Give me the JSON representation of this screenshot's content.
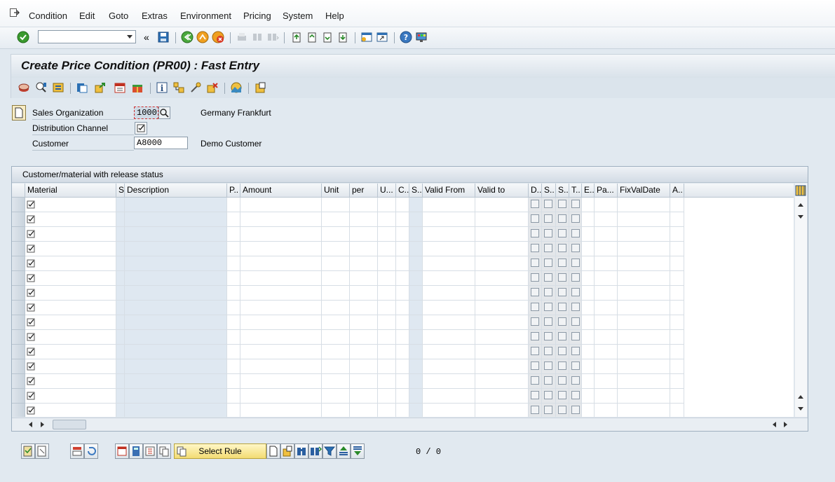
{
  "menu": [
    "Condition",
    "Edit",
    "Goto",
    "Extras",
    "Environment",
    "Pricing",
    "System",
    "Help"
  ],
  "title": "Create Price Condition (PR00) : Fast Entry",
  "fields": {
    "sales_org_label": "Sales Organization",
    "sales_org_value": "1000",
    "sales_org_desc": "Germany Frankfurt",
    "dist_channel_label": "Distribution Channel",
    "customer_label": "Customer",
    "customer_value": "A8000",
    "customer_desc": "Demo Customer"
  },
  "table": {
    "title": "Customer/material with release status",
    "headers": [
      "Material",
      "S",
      "Description",
      "P..",
      "Amount",
      "Unit",
      "per",
      "U...",
      "C..",
      "S..",
      "Valid From",
      "Valid to",
      "D..",
      "S..",
      "S..",
      "T..",
      "E..",
      "Pa...",
      "FixValDate",
      "A.."
    ],
    "row_count": 15
  },
  "bottom": {
    "select_rule_label": "Select Rule",
    "page_counter": "0  /  0"
  },
  "colors": {
    "background": "#e1e9f0",
    "title_bar": "#d9e2ea",
    "readonly_cell": "#dfe8f1",
    "select_rule_button": "#f3dc73"
  },
  "icons": [
    "enter-icon",
    "save-icon",
    "back-icon",
    "exit-icon",
    "cancel-icon",
    "print-icon",
    "find-icon",
    "find-next-icon",
    "first-page-icon",
    "prev-page-icon",
    "next-page-icon",
    "last-page-icon",
    "new-session-icon",
    "shortcut-icon",
    "help-icon",
    "customize-layout-icon"
  ]
}
